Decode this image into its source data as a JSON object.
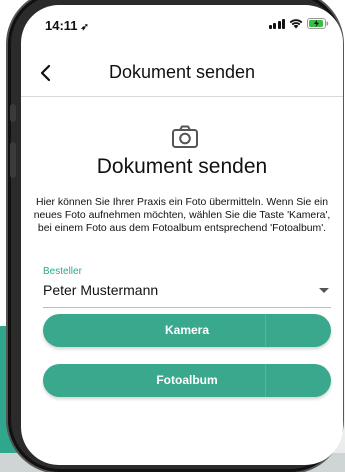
{
  "status_bar": {
    "time": "14:11"
  },
  "nav": {
    "title": "Dokument senden"
  },
  "content": {
    "title": "Dokument senden",
    "description": "Hier können Sie Ihrer Praxis ein Foto übermitteln. Wenn Sie ein neues Foto aufnehmen möchten, wählen Sie die Taste 'Kamera', bei einem Foto aus dem Fotoalbum entsprechend 'Fotoalbum'."
  },
  "form": {
    "orderer_label": "Besteller",
    "orderer_value": "Peter Mustermann"
  },
  "buttons": {
    "camera_label": "Kamera",
    "album_label": "Fotoalbum"
  },
  "colors": {
    "accent": "#3aa88c",
    "label": "#2fa78c"
  }
}
